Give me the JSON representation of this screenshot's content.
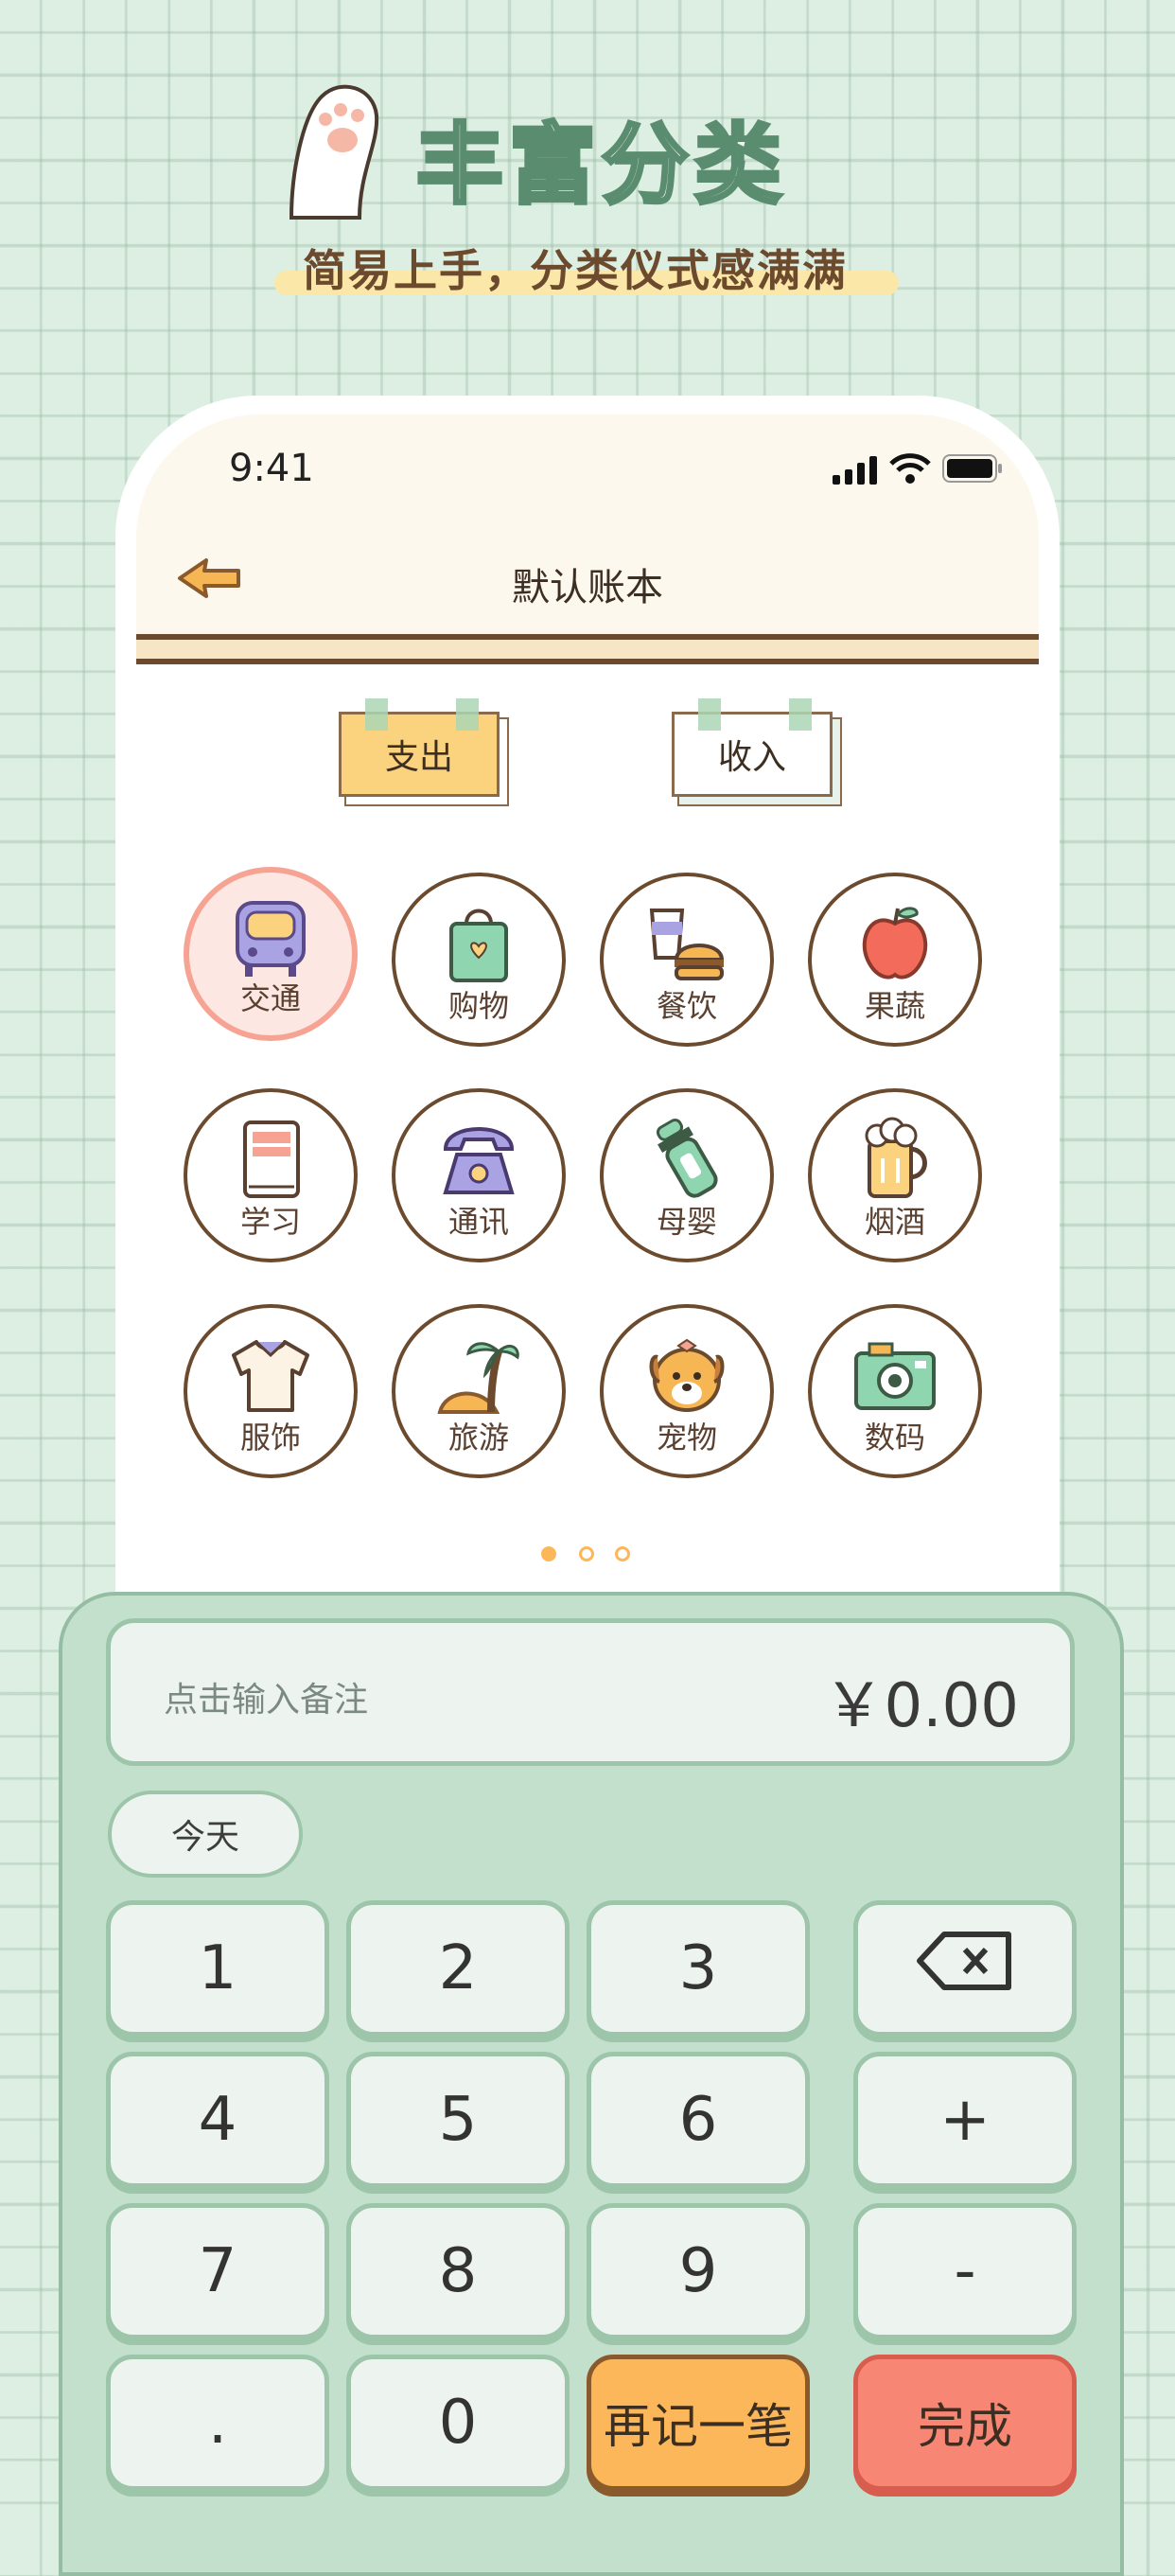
{
  "header": {
    "title": "丰富分类",
    "subtitle": "简易上手，分类仪式感满满"
  },
  "status_bar": {
    "time": "9:41"
  },
  "nav": {
    "title": "默认账本"
  },
  "tabs": [
    {
      "label": "支出",
      "selected": true
    },
    {
      "label": "收入",
      "selected": false
    }
  ],
  "categories": [
    {
      "label": "交通",
      "icon": "bus-icon",
      "selected": true
    },
    {
      "label": "购物",
      "icon": "shopping-bag-icon"
    },
    {
      "label": "餐饮",
      "icon": "burger-drink-icon"
    },
    {
      "label": "果蔬",
      "icon": "apple-icon"
    },
    {
      "label": "学习",
      "icon": "book-icon"
    },
    {
      "label": "通讯",
      "icon": "telephone-icon"
    },
    {
      "label": "母婴",
      "icon": "baby-bottle-icon"
    },
    {
      "label": "烟酒",
      "icon": "beer-icon"
    },
    {
      "label": "服饰",
      "icon": "shirt-icon"
    },
    {
      "label": "旅游",
      "icon": "palm-tree-icon"
    },
    {
      "label": "宠物",
      "icon": "dog-icon"
    },
    {
      "label": "数码",
      "icon": "camera-icon"
    }
  ],
  "pager": {
    "pages": 3,
    "current": 1
  },
  "keypad": {
    "note_placeholder": "点击输入备注",
    "amount": "￥0.00",
    "date_button": "今天",
    "keys": {
      "k1": "1",
      "k2": "2",
      "k3": "3",
      "k4": "4",
      "k5": "5",
      "k6": "6",
      "k7": "7",
      "k8": "8",
      "k9": "9",
      "dot": ".",
      "k0": "0",
      "plus": "+",
      "minus": "-",
      "again": "再记一笔",
      "done": "完成"
    }
  },
  "colors": {
    "background": "#dcefe2",
    "accent_orange": "#fbb75a",
    "accent_red": "#f88674",
    "brown": "#6b4a2e",
    "selected_pink": "#f6a394"
  }
}
